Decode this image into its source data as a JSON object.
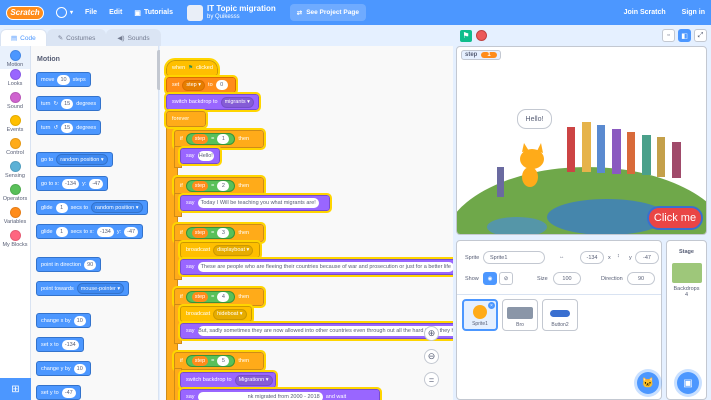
{
  "menubar": {
    "logo": "Scratch",
    "file": "File",
    "edit": "Edit",
    "tutorials": "Tutorials",
    "project_title": "IT Topic migration",
    "project_by": "by Quikesss",
    "see_project_page": "See Project Page",
    "join": "Join Scratch",
    "signin": "Sign in"
  },
  "tabs": {
    "code": "Code",
    "costumes": "Costumes",
    "sounds": "Sounds"
  },
  "categories": [
    {
      "label": "Motion",
      "color": "#4c97ff"
    },
    {
      "label": "Looks",
      "color": "#9966ff"
    },
    {
      "label": "Sound",
      "color": "#cf63cf"
    },
    {
      "label": "Events",
      "color": "#ffbf00"
    },
    {
      "label": "Control",
      "color": "#ffab19"
    },
    {
      "label": "Sensing",
      "color": "#5cb1d6"
    },
    {
      "label": "Operators",
      "color": "#59c059"
    },
    {
      "label": "Variables",
      "color": "#ff8c1a"
    },
    {
      "label": "My Blocks",
      "color": "#ff6680"
    }
  ],
  "palette": {
    "section": "Motion",
    "move": "move",
    "move_n": "10",
    "steps": "steps",
    "turn": "turn",
    "turn_n": "15",
    "degrees": "degrees",
    "goto": "go to",
    "random_position": "random position",
    "gotoxy": "go to x:",
    "x1": "-134",
    "y_label": "y:",
    "y1": "-47",
    "glide": "glide",
    "glide_n": "1",
    "secs_to": "secs to",
    "secs_to_x": "secs to x:",
    "point_dir": "point in direction",
    "dir_n": "90",
    "point_towards": "point towards",
    "mouse_pointer": "mouse-pointer",
    "change_x": "change x by",
    "cx_n": "10",
    "set_x": "set x to",
    "sx_n": "-134",
    "change_y": "change y by",
    "cy_n": "10",
    "set_y": "set y to",
    "sy_n": "-47"
  },
  "script": {
    "when": "when",
    "clicked": "clicked",
    "set": "set",
    "step": "step",
    "to": "to",
    "zero": "0",
    "switch_backdrop": "switch backdrop to",
    "migrants": "migrants",
    "forever": "forever",
    "if": "if",
    "then": "then",
    "eq": "=",
    "say": "say",
    "n1": "1",
    "say1": "Hello!",
    "n2": "2",
    "say2": "Today I Will be teaching you what migrants are!",
    "n3": "3",
    "broadcast": "broadcast",
    "displayboat": "displayboat",
    "say3": "These are people who are fleeing their countries because of war and prosecution or just for a better life",
    "n4": "4",
    "hideboat": "hideboat",
    "say4": "But, sadly sometimes they are now allowed into other countries even through out all the hard times they have",
    "n5": "5",
    "migrationn": "Migrationn",
    "say5": "nk migrated from 2000 - 2018",
    "and_wait": "and wait"
  },
  "stage": {
    "var_name": "step",
    "var_value": "1",
    "speech": "Hello!",
    "click_me": "Click me"
  },
  "sprite_info": {
    "sprite_label": "Sprite",
    "sprite_name": "Sprite1",
    "x_label": "x",
    "x": "-134",
    "y_label": "y",
    "y": "-47",
    "show_label": "Show",
    "size_label": "Size",
    "size": "100",
    "direction_label": "Direction",
    "direction": "90"
  },
  "sprites": [
    {
      "name": "Sprite1"
    },
    {
      "name": "Bro"
    },
    {
      "name": "Button2"
    }
  ],
  "stage_panel": {
    "title": "Stage",
    "backdrops_label": "Backdrops",
    "backdrops_count": "4"
  }
}
